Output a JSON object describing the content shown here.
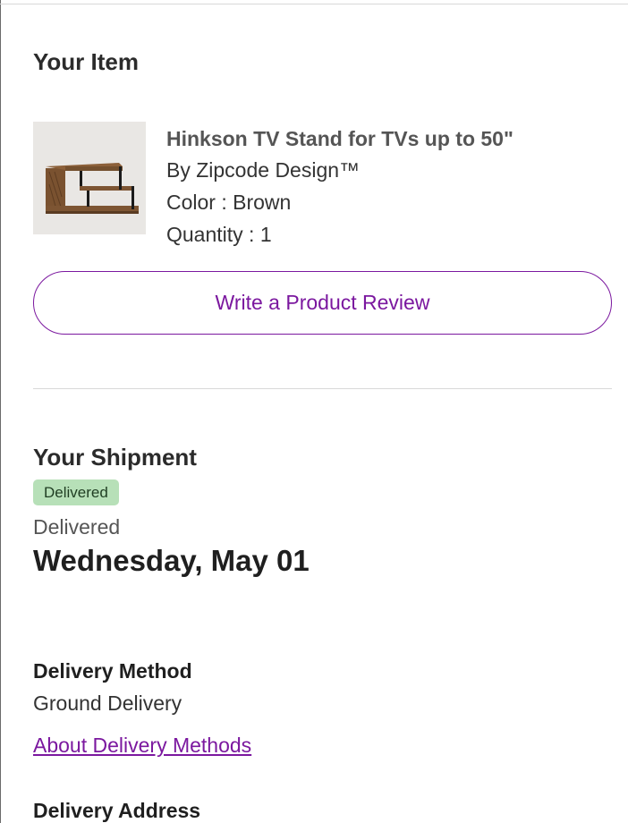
{
  "item_section": {
    "title": "Your Item",
    "product": {
      "name": "Hinkson TV Stand for TVs up to 50\"",
      "brand": "By Zipcode Design™",
      "color": "Color : Brown",
      "quantity": "Quantity : 1",
      "image_icon": "tv-stand-image"
    },
    "review_button_label": "Write a Product Review"
  },
  "shipment_section": {
    "title": "Your Shipment",
    "badge": "Delivered",
    "status_label": "Delivered",
    "status_date": "Wednesday, May 01"
  },
  "delivery_method": {
    "title": "Delivery Method",
    "value": "Ground Delivery",
    "link_label": "About Delivery Methods"
  },
  "delivery_address": {
    "title": "Delivery Address"
  },
  "colors": {
    "accent": "#7b189f",
    "badge_bg": "#b7e0b8",
    "divider": "#d8d8d8"
  }
}
